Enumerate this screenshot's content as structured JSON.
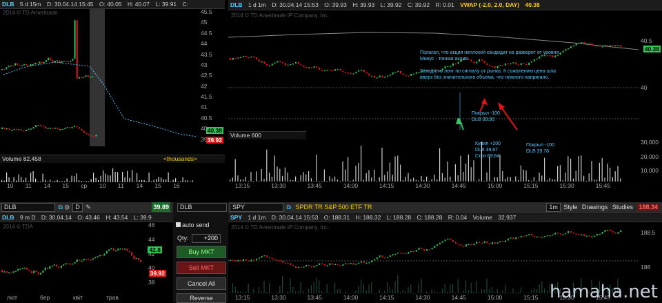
{
  "left_chart": {
    "header": {
      "symbol": "DLB",
      "period": "5 d 15m",
      "date": "D: 30.04.14 15:45",
      "open": "O: 40.05",
      "high": "H: 40.07",
      "low": "L: 39.91",
      "close": "C:"
    },
    "copyright": "2014 © TD Ameritrade",
    "y_ticks": [
      "45.5",
      "45",
      "44.5",
      "44",
      "43.5",
      "43",
      "42.5",
      "42",
      "41.5",
      "41",
      "40.5",
      "40",
      "39.5"
    ],
    "price_tags": {
      "vwap": "40.38",
      "last": "39.92"
    },
    "volume_label": "Volume",
    "volume_value": "82,458",
    "thousands": "<thousands>",
    "x_ticks": [
      "10",
      "11",
      "14",
      "15",
      "ср",
      "10",
      "11",
      "14",
      "15",
      "16"
    ]
  },
  "main_chart": {
    "header": {
      "symbol": "DLB",
      "period": "1 d 1m",
      "date": "D: 30.04.14 15:53",
      "open": "O: 39.93",
      "high": "H: 39.93",
      "low": "L: 39.92",
      "close": "C: 39.92",
      "range": "R: 0.01",
      "study": "VWAP (-2.0, 2.0, DAY)",
      "study_value": "40.38"
    },
    "copyright": "2014 © TD Ameritrade IP Company, Inc.",
    "y_ticks": [
      "40.5",
      "40"
    ],
    "price_tag": "40.38",
    "annotation_top": "Полагал, что акция неплохой кандидат на разворот от уровня.\nМинус - тонкая акция.\n\nЗаходил в лонг по сигналу от рынка. К сожалению цена шла\nвверх без значительного объема, что немного напрягало.",
    "note_cover_mid": "Покрыл -100\nDLB 39.90",
    "note_buy": "Купил +200\nDLB 39.67\nСтоп 69.64",
    "note_cover_right": "Покрыл -100\nDLB 39.78",
    "volume_label": "Volume",
    "volume_value": "600",
    "vol_ticks": [
      "30,000",
      "20,000",
      "10,000"
    ],
    "x_ticks": [
      "13:15",
      "13:30",
      "13:45",
      "14:00",
      "14:15",
      "14:30",
      "14:45",
      "15:00",
      "15:15",
      "15:30",
      "15:45"
    ]
  },
  "bottom_left": {
    "symbol_box": "DLB",
    "last_price": "39.89",
    "change": "+0.28%",
    "header": {
      "symbol": "DLB",
      "period": "9 m D",
      "date": "D: 30.04.14",
      "open": "O: 43.46",
      "high": "H: 43.54",
      "low": "L: 39.9"
    },
    "copyright": "2014 © TDA",
    "y_ticks": [
      "46",
      "44",
      "42",
      "40",
      "38"
    ],
    "price_tags": {
      "a": "42.8",
      "b": "39.92"
    },
    "x_ticks": [
      "лют",
      "бер",
      "квіт",
      "трав"
    ]
  },
  "order_panel": {
    "symbol": "DLB",
    "auto_send": "auto send",
    "qty_label": "Qty:",
    "qty_value": "+200",
    "buy": "Buy MKT",
    "sell": "Sell MKT",
    "cancel": "Cancel All",
    "reverse": "Reverse"
  },
  "spy_chart": {
    "symbol_box": "SPY",
    "description": "SPDR TR S&P 500 ETF TR",
    "interval": "1m",
    "style": "Style",
    "drawings": "Drawings",
    "studies": "Studies",
    "last_price": "188.34",
    "change": "+0.35%",
    "header": {
      "symbol": "SPY",
      "period": "1 d 1m",
      "date": "D: 30.04.14 15:53",
      "open": "O: 188.31",
      "high": "H: 188.32",
      "low": "L: 188.28",
      "close": "C: 188.28",
      "range": "R: 0.04",
      "volume": "Volume",
      "volume_value": "32,937"
    },
    "copyright": "2014 © TD Ameritrade IP Company, Inc.",
    "y_ticks": [
      "188.5",
      "188"
    ],
    "x_ticks": [
      "13:15",
      "13:30",
      "13:45",
      "14:00",
      "14:15",
      "14:30",
      "14:45",
      "15:00",
      "15:15",
      "15:30",
      "15:45"
    ]
  },
  "watermark": "hamaha.net",
  "colors": {
    "up": "#2ec456",
    "down": "#e01515",
    "vwap": "#4fc8ff",
    "accent": "#4fd4ff"
  }
}
